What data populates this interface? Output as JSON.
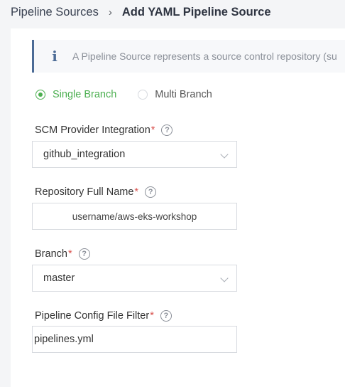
{
  "breadcrumb": {
    "parent": "Pipeline Sources",
    "separator": "›",
    "current": "Add YAML Pipeline Source"
  },
  "info": {
    "icon": "info-icon",
    "text": "A Pipeline Source represents a source control repository (su"
  },
  "branch_mode": {
    "options": [
      "Single Branch",
      "Multi Branch"
    ],
    "selected": "Single Branch",
    "accent": "#4caf50"
  },
  "fields": {
    "scm_provider": {
      "label": "SCM Provider Integration",
      "required": "*",
      "help": "?",
      "value": "github_integration"
    },
    "repository": {
      "label": "Repository Full Name",
      "required": "*",
      "help": "?",
      "value": "username/aws-eks-workshop"
    },
    "branch": {
      "label": "Branch",
      "required": "*",
      "help": "?",
      "value": "master"
    },
    "config_filter": {
      "label": "Pipeline Config File Filter",
      "required": "*",
      "help": "?",
      "value": "pipelines.yml"
    }
  }
}
